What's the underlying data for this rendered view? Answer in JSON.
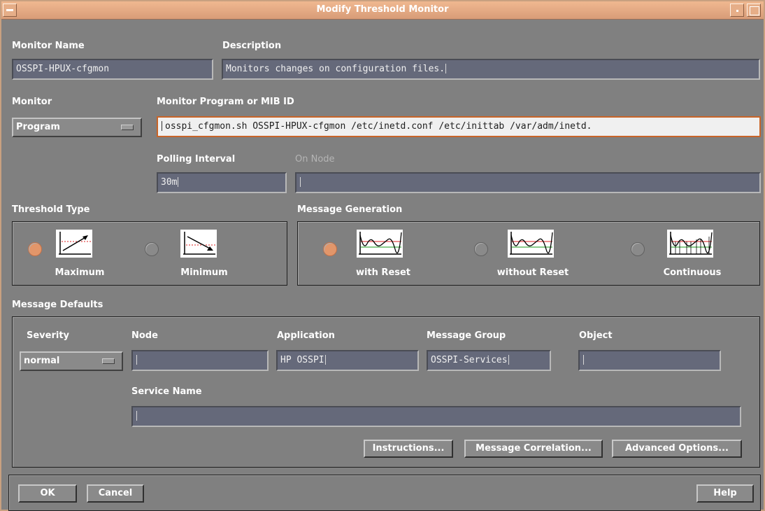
{
  "window": {
    "title": "Modify Threshold Monitor"
  },
  "monitor_name": {
    "label": "Monitor Name",
    "value": "OSSPI-HPUX-cfgmon"
  },
  "description": {
    "label": "Description",
    "value": "Monitors changes on configuration files."
  },
  "monitor": {
    "label": "Monitor",
    "value": "Program"
  },
  "monitor_program": {
    "label": "Monitor Program or MIB ID",
    "value": "osspi_cfgmon.sh OSSPI-HPUX-cfgmon   /etc/inetd.conf /etc/inittab /var/adm/inetd."
  },
  "polling_interval": {
    "label": "Polling Interval",
    "value": "30m"
  },
  "on_node": {
    "label": "On Node",
    "value": ""
  },
  "threshold_type": {
    "label": "Threshold Type",
    "options": [
      {
        "label": "Maximum",
        "selected": true,
        "icon": "threshold-maximum-icon"
      },
      {
        "label": "Minimum",
        "selected": false,
        "icon": "threshold-minimum-icon"
      }
    ]
  },
  "message_generation": {
    "label": "Message Generation",
    "options": [
      {
        "label": "with Reset",
        "selected": true,
        "icon": "with-reset-graph-icon"
      },
      {
        "label": "without Reset",
        "selected": false,
        "icon": "without-reset-graph-icon"
      },
      {
        "label": "Continuous",
        "selected": false,
        "icon": "continuous-graph-icon"
      }
    ]
  },
  "message_defaults": {
    "label": "Message Defaults",
    "severity": {
      "label": "Severity",
      "value": "normal"
    },
    "node": {
      "label": "Node",
      "value": ""
    },
    "application": {
      "label": "Application",
      "value": "HP OSSPI"
    },
    "message_group": {
      "label": "Message Group",
      "value": "OSSPI-Services"
    },
    "object": {
      "label": "Object",
      "value": ""
    },
    "service_name": {
      "label": "Service Name",
      "value": ""
    },
    "buttons": {
      "instructions": "Instructions...",
      "correlation": "Message Correlation...",
      "advanced": "Advanced Options..."
    }
  },
  "footer": {
    "ok": "OK",
    "cancel": "Cancel",
    "help": "Help"
  },
  "colors": {
    "selected_radio": "#e2966a",
    "titlebar": "#e6ae88",
    "field": "#65697a",
    "background": "#808080"
  }
}
